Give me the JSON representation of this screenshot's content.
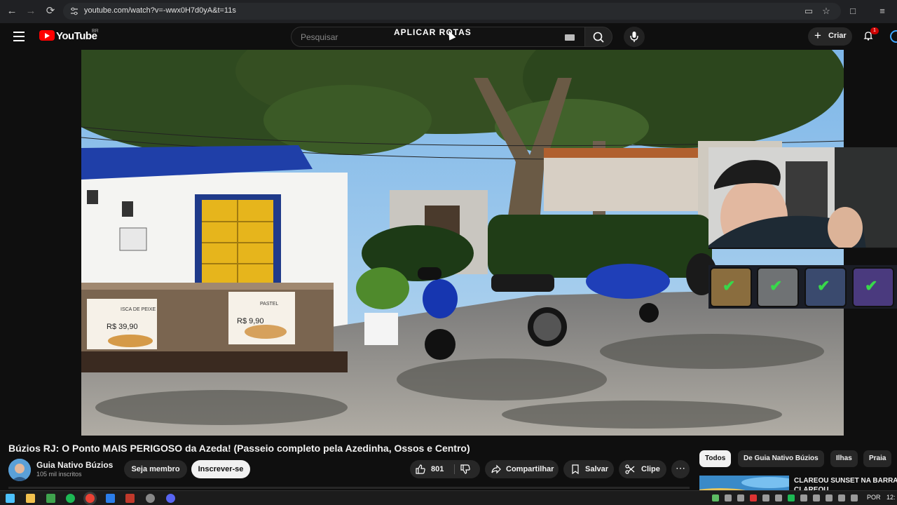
{
  "browser": {
    "url": "youtube.com/watch?v=-wwx0H7d0yA&t=11s",
    "icons": [
      "back-icon",
      "forward-icon",
      "reload-icon",
      "site-info-icon",
      "cast-icon",
      "bookmark-star-icon",
      "extensions-icon",
      "media-icon"
    ]
  },
  "header": {
    "logo_text": "YouTube",
    "country_code": "BR",
    "search_placeholder": "Pesquisar",
    "overlay_title": "APLICAR ROTAS",
    "create_label": "Criar",
    "notification_count": "1"
  },
  "video": {
    "menu_sign_1": "ISCA DE PEIXE",
    "menu_price_1": "R$ 39,90",
    "menu_sign_2": "PASTEL",
    "menu_price_2": "R$ 9,90"
  },
  "overlay_items": [
    "check-icon",
    "check-icon",
    "check-icon",
    "check-icon"
  ],
  "meta": {
    "title": "Búzios RJ: O Ponto MAIS PERIGOSO da Azeda! (Passeio completo pela Azedinha, Ossos e Centro)",
    "channel_name": "Guia Nativo Búzios",
    "subscribers": "105 mil inscritos",
    "join_label": "Seja membro",
    "subscribe_label": "Inscrever-se",
    "likes": "801",
    "share_label": "Compartilhar",
    "save_label": "Salvar",
    "clip_label": "Clipe"
  },
  "chips": [
    "Todos",
    "De Guia Nativo Búzios",
    "Ilhas",
    "Praia"
  ],
  "suggestion": {
    "title": "CLAREOU SUNSET NA BARRA CLAREOU"
  },
  "taskbar": {
    "language": "POR",
    "clock": "12:"
  },
  "colors": {
    "background": "#0f0f0f",
    "brand_red": "#ff0000",
    "check_green": "#38d84a",
    "link_blue": "#3ea6ff"
  }
}
